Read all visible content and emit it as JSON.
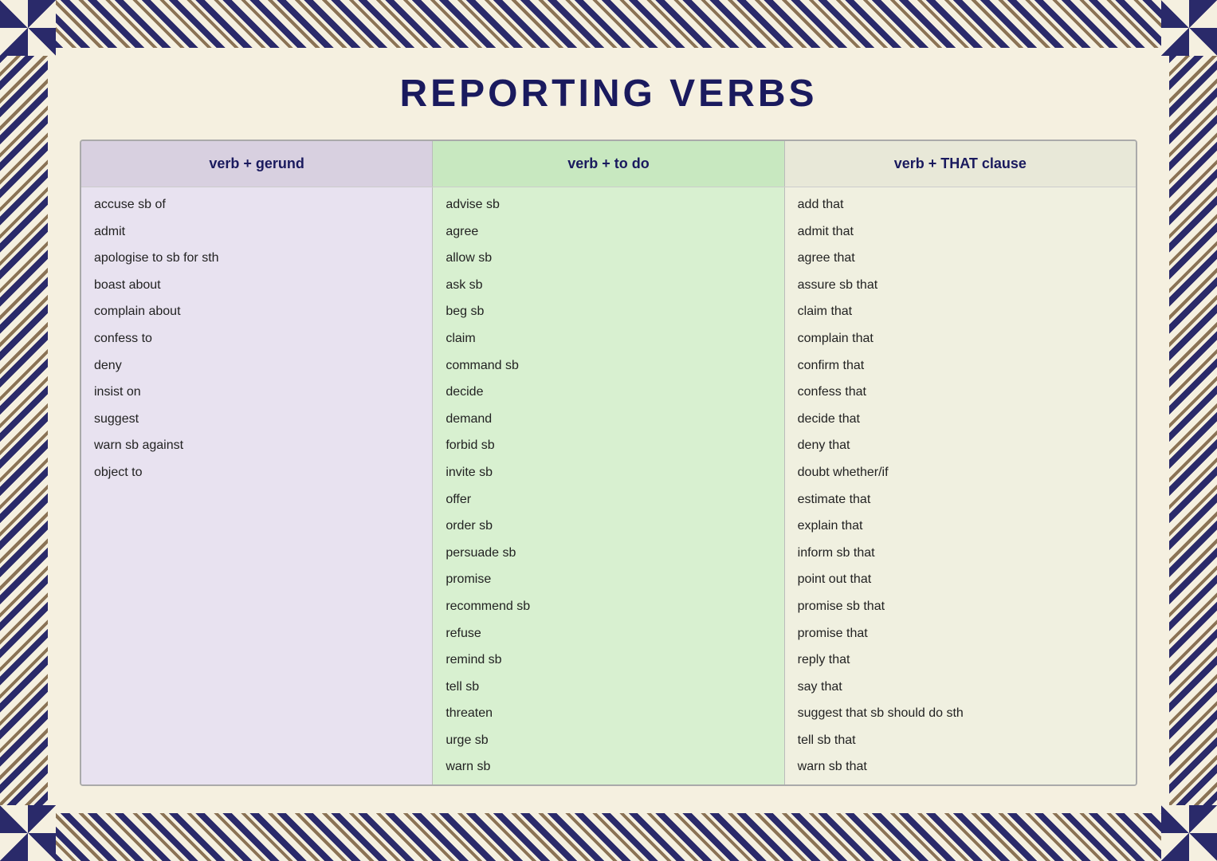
{
  "title": "REPORTING VERBS",
  "columns": [
    {
      "id": "gerund",
      "header": "verb + gerund",
      "items": [
        "accuse sb of",
        "admit",
        "apologise to sb for sth",
        "boast about",
        "complain about",
        "confess to",
        "deny",
        "insist on",
        "suggest",
        "warn sb against",
        "object to"
      ]
    },
    {
      "id": "todo",
      "header": "verb + to do",
      "items": [
        "advise sb",
        "agree",
        "allow sb",
        "ask sb",
        "beg sb",
        "claim",
        "command sb",
        "decide",
        "demand",
        "forbid sb",
        "invite sb",
        "offer",
        "order sb",
        "persuade sb",
        "promise",
        "recommend sb",
        "refuse",
        "remind sb",
        "tell sb",
        "threaten",
        "urge sb",
        "warn sb"
      ]
    },
    {
      "id": "that",
      "header": "verb + THAT clause",
      "items": [
        "add that",
        "admit that",
        "agree that",
        "assure sb that",
        "claim that",
        "complain that",
        "confirm that",
        "confess that",
        "decide that",
        "deny that",
        "doubt whether/if",
        "estimate that",
        "explain that",
        "inform sb that",
        "point out that",
        "promise sb that",
        "promise that",
        "reply that",
        "say that",
        "suggest that sb should do sth",
        "tell sb that",
        "warn sb that"
      ]
    }
  ]
}
